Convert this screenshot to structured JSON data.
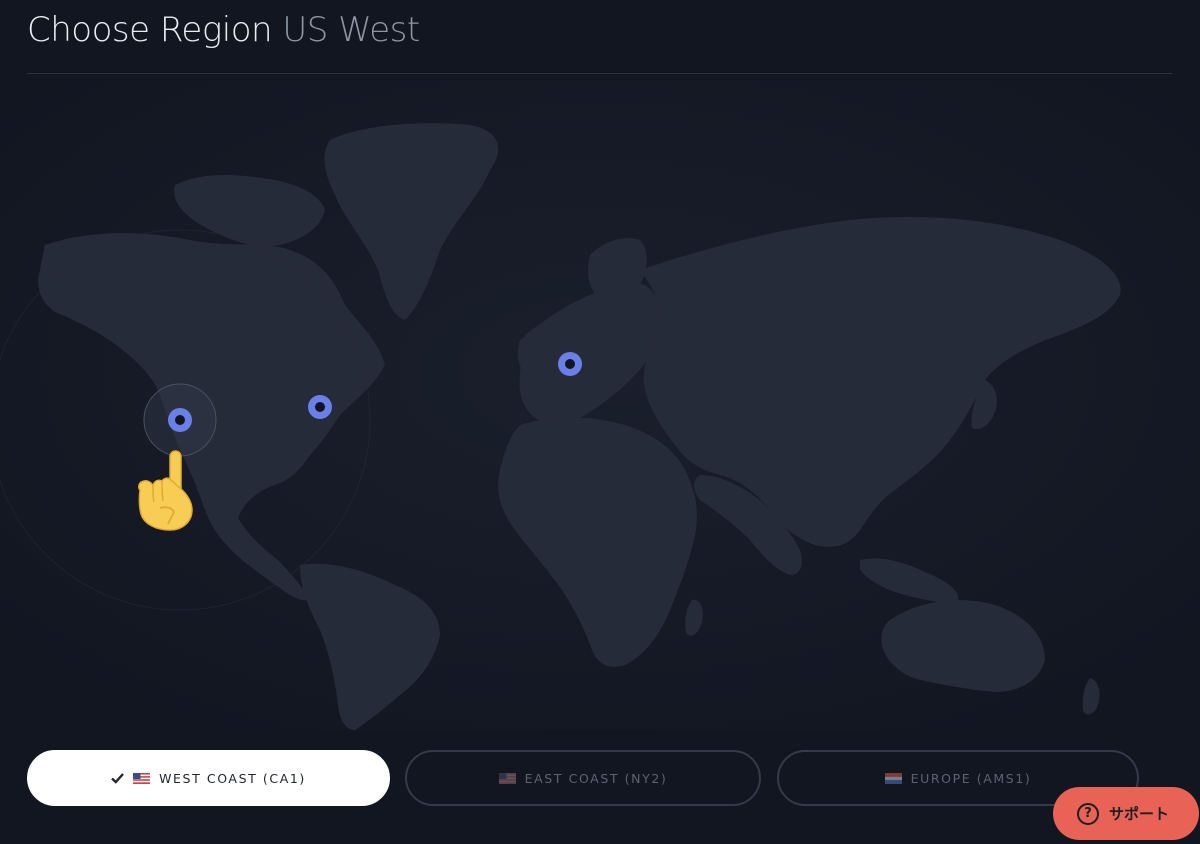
{
  "header": {
    "title_prefix": "Choose Region",
    "title_region": "US West"
  },
  "regions": [
    {
      "label": "WEST COAST (CA1)",
      "flag": "us-flag",
      "selected": true
    },
    {
      "label": "EAST COAST (NY2)",
      "flag": "us-flag",
      "selected": false
    },
    {
      "label": "EUROPE (AMS1)",
      "flag": "nl-flag",
      "selected": false
    }
  ],
  "support": {
    "label": "サポート",
    "icon": "question-icon"
  },
  "colors": {
    "background": "#121621",
    "land": "#262b39",
    "marker": "#6b7fe8",
    "support_button": "#e86355",
    "selected_button": "#ffffff"
  },
  "pointer": {
    "glyph": "☝️",
    "icon": "pointing-hand-icon"
  }
}
